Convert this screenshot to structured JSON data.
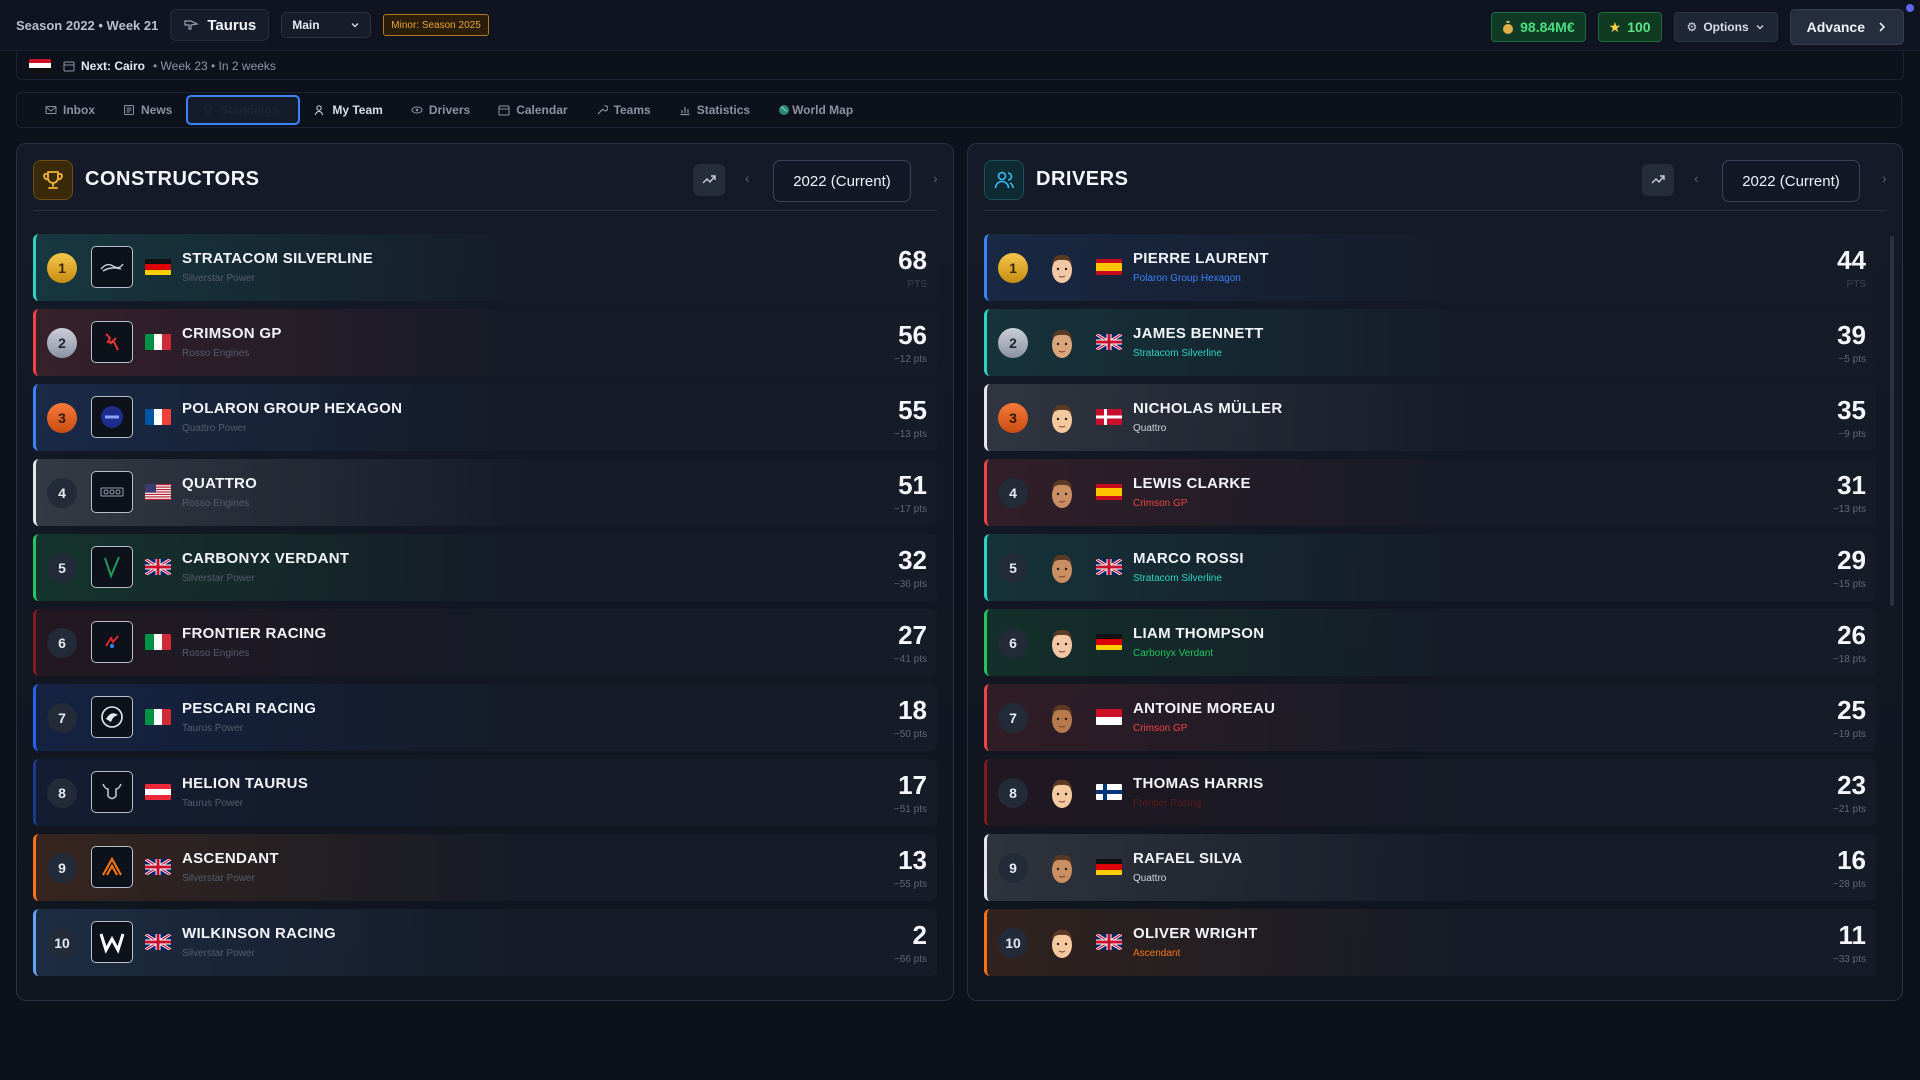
{
  "topbar": {
    "season_label": "Season 2022 • Week 21",
    "team": "Taurus",
    "mode": "Main",
    "minor_badge": "Minor: Season 2025",
    "money": "98.84M€",
    "stars": "100",
    "options_label": "Options",
    "advance_label": "Advance"
  },
  "next_race": {
    "label": "Next: Cairo",
    "meta": "• Week 23 • In 2 weeks"
  },
  "nav": {
    "tabs": [
      {
        "label": "Inbox"
      },
      {
        "label": "News"
      },
      {
        "label": "Standings"
      },
      {
        "label": "My Team"
      },
      {
        "label": "Drivers"
      },
      {
        "label": "Calendar"
      },
      {
        "label": "Teams"
      },
      {
        "label": "Statistics"
      },
      {
        "label": "World Map"
      }
    ]
  },
  "constructors": {
    "title": "CONSTRUCTORS",
    "season": "2022 (Current)",
    "rows": [
      {
        "pos": "1",
        "name": "STRATACOM SILVERLINE",
        "sub": "Silverstar Power",
        "pts": "68",
        "gap": "PTS",
        "color": "#2dd4bf",
        "flag": "de"
      },
      {
        "pos": "2",
        "name": "CRIMSON GP",
        "sub": "Rosso Engines",
        "pts": "56",
        "gap": "−12 pts",
        "color": "#ef4444",
        "flag": "it"
      },
      {
        "pos": "3",
        "name": "POLARON GROUP HEXAGON",
        "sub": "Quattro Power",
        "pts": "55",
        "gap": "−13 pts",
        "color": "#3b82f6",
        "flag": "fr"
      },
      {
        "pos": "4",
        "name": "QUATTRO",
        "sub": "Rosso Engines",
        "pts": "51",
        "gap": "−17 pts",
        "color": "#e5e7eb",
        "flag": "us"
      },
      {
        "pos": "5",
        "name": "CARBONYX VERDANT",
        "sub": "Silverstar Power",
        "pts": "32",
        "gap": "−36 pts",
        "color": "#22c55e",
        "flag": "gb"
      },
      {
        "pos": "6",
        "name": "FRONTIER RACING",
        "sub": "Rosso Engines",
        "pts": "27",
        "gap": "−41 pts",
        "color": "#7f1d1d",
        "flag": "it"
      },
      {
        "pos": "7",
        "name": "PESCARI RACING",
        "sub": "Taurus Power",
        "pts": "18",
        "gap": "−50 pts",
        "color": "#2563eb",
        "flag": "it"
      },
      {
        "pos": "8",
        "name": "HELION TAURUS",
        "sub": "Taurus Power",
        "pts": "17",
        "gap": "−51 pts",
        "color": "#1e3a8a",
        "flag": "at"
      },
      {
        "pos": "9",
        "name": "ASCENDANT",
        "sub": "Silverstar Power",
        "pts": "13",
        "gap": "−55 pts",
        "color": "#f97316",
        "flag": "gb"
      },
      {
        "pos": "10",
        "name": "WILKINSON RACING",
        "sub": "Silverstar Power",
        "pts": "2",
        "gap": "−66 pts",
        "color": "#60a5fa",
        "flag": "gb"
      }
    ]
  },
  "drivers": {
    "title": "DRIVERS",
    "season": "2022 (Current)",
    "rows": [
      {
        "pos": "1",
        "name": "PIERRE LAURENT",
        "sub": "Polaron Group Hexagon",
        "sub_color": "#3b82f6",
        "pts": "44",
        "gap": "PTS",
        "color": "#3b82f6",
        "flag": "es",
        "skin": "#f1c7a6"
      },
      {
        "pos": "2",
        "name": "JAMES BENNETT",
        "sub": "Stratacom Silverline",
        "sub_color": "#2dd4bf",
        "pts": "39",
        "gap": "−5 pts",
        "color": "#2dd4bf",
        "flag": "gb",
        "skin": "#d9a67c"
      },
      {
        "pos": "3",
        "name": "NICHOLAS MÜLLER",
        "sub": "Quattro",
        "sub_color": "#d1d5db",
        "pts": "35",
        "gap": "−9 pts",
        "color": "#e5e7eb",
        "flag": "dk",
        "skin": "#f4c9a0"
      },
      {
        "pos": "4",
        "name": "LEWIS CLARKE",
        "sub": "Crimson GP",
        "sub_color": "#ef4444",
        "pts": "31",
        "gap": "−13 pts",
        "color": "#ef4444",
        "flag": "es",
        "skin": "#c98e62"
      },
      {
        "pos": "5",
        "name": "MARCO ROSSI",
        "sub": "Stratacom Silverline",
        "sub_color": "#2dd4bf",
        "pts": "29",
        "gap": "−15 pts",
        "color": "#2dd4bf",
        "flag": "gb",
        "skin": "#c98e62"
      },
      {
        "pos": "6",
        "name": "LIAM THOMPSON",
        "sub": "Carbonyx Verdant",
        "sub_color": "#22c55e",
        "pts": "26",
        "gap": "−18 pts",
        "color": "#22c55e",
        "flag": "de",
        "skin": "#f1c7a6"
      },
      {
        "pos": "7",
        "name": "ANTOINE MOREAU",
        "sub": "Crimson GP",
        "sub_color": "#ef4444",
        "pts": "25",
        "gap": "−19 pts",
        "color": "#ef4444",
        "flag": "mc",
        "skin": "#b67a4e"
      },
      {
        "pos": "8",
        "name": "THOMAS HARRIS",
        "sub": "Frontier Racing",
        "sub_color": "#5c1a1a",
        "pts": "23",
        "gap": "−21 pts",
        "color": "#7f1d1d",
        "flag": "fi",
        "skin": "#f4c9a0"
      },
      {
        "pos": "9",
        "name": "RAFAEL SILVA",
        "sub": "Quattro",
        "sub_color": "#d1d5db",
        "pts": "16",
        "gap": "−28 pts",
        "color": "#e5e7eb",
        "flag": "de",
        "skin": "#c98e62"
      },
      {
        "pos": "10",
        "name": "OLIVER WRIGHT",
        "sub": "Ascendant",
        "sub_color": "#f97316",
        "pts": "11",
        "gap": "−33 pts",
        "color": "#f97316",
        "flag": "gb",
        "skin": "#f4c9a0"
      }
    ]
  }
}
